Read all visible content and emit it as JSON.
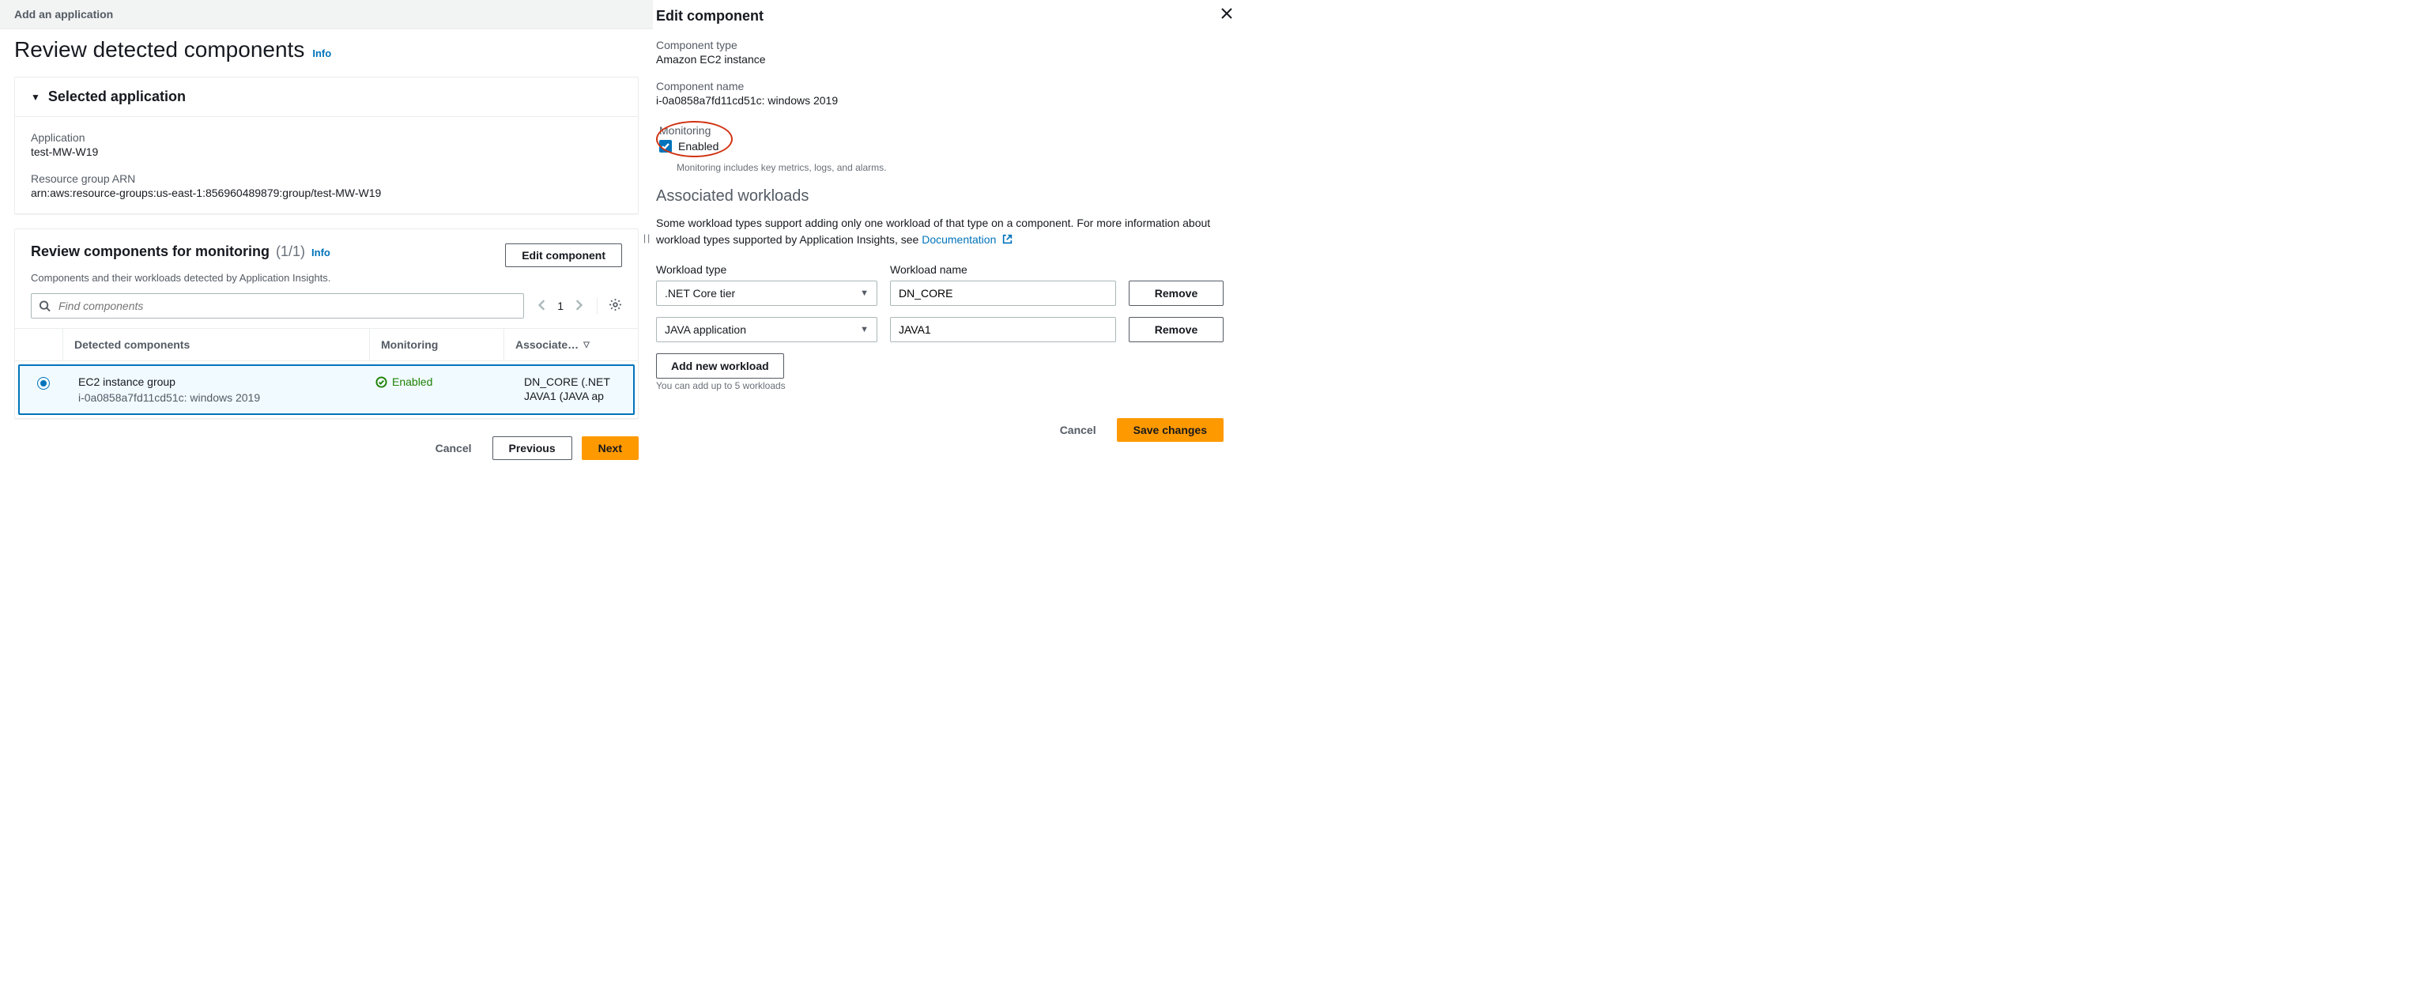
{
  "left": {
    "header": "Add an application",
    "title": "Review detected components",
    "info": "Info",
    "selected_app": {
      "header": "Selected application",
      "app_label": "Application",
      "app_value": "test-MW-W19",
      "arn_label": "Resource group ARN",
      "arn_value": "arn:aws:resource-groups:us-east-1:856960489879:group/test-MW-W19"
    },
    "components": {
      "title": "Review components for monitoring",
      "count": "(1/1)",
      "info": "Info",
      "desc": "Components and their workloads detected by Application Insights.",
      "edit_btn": "Edit component",
      "search_placeholder": "Find components",
      "page": "1",
      "cols": {
        "c1": "Detected components",
        "c2": "Monitoring",
        "c3": "Associate…"
      },
      "row": {
        "title": "EC2 instance group",
        "sub": "i-0a0858a7fd11cd51c: windows 2019",
        "status": "Enabled",
        "assoc": [
          "DN_CORE (.NET",
          "JAVA1 (JAVA ap"
        ]
      }
    },
    "footer": {
      "cancel": "Cancel",
      "prev": "Previous",
      "next": "Next"
    }
  },
  "right": {
    "title": "Edit component",
    "type_label": "Component type",
    "type_value": "Amazon EC2 instance",
    "name_label": "Component name",
    "name_value": "i-0a0858a7fd11cd51c: windows 2019",
    "mon_label": "Monitoring",
    "mon_check": "Enabled",
    "mon_hint": "Monitoring includes key metrics, logs, and alarms.",
    "assoc_header": "Associated workloads",
    "assoc_para1": "Some workload types support adding only one workload of that type on a component. For more information about workload types supported by Application Insights, see ",
    "assoc_link": "Documentation",
    "wl_type_label": "Workload type",
    "wl_name_label": "Workload name",
    "rows": [
      {
        "type": ".NET Core tier",
        "name": "DN_CORE"
      },
      {
        "type": "JAVA application",
        "name": "JAVA1"
      }
    ],
    "remove": "Remove",
    "add": "Add new workload",
    "hint": "You can add up to 5 workloads",
    "footer": {
      "cancel": "Cancel",
      "save": "Save changes"
    }
  }
}
